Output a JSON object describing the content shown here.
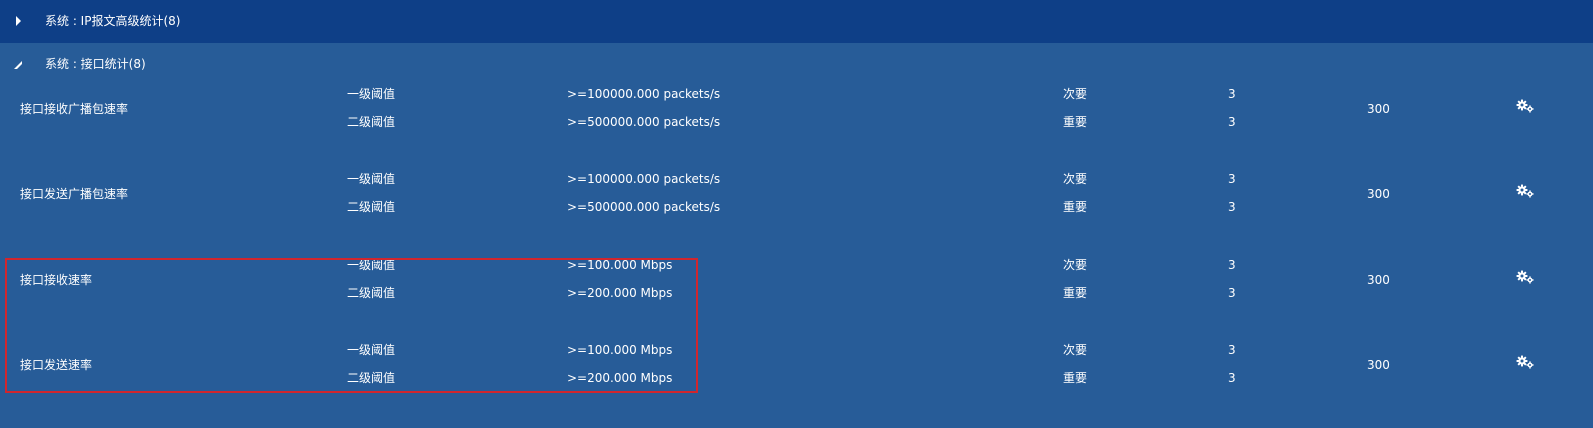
{
  "groups": {
    "collapsed": {
      "title": "系统 : IP报文高级统计(8)",
      "icon": "caret-right-icon"
    },
    "expanded": {
      "title": "系统 : 接口统计(8)",
      "icon": "caret-down-icon"
    }
  },
  "rows": [
    {
      "metric": "接口接收广播包速率",
      "levels": [
        {
          "level": "一级阈值",
          "condition": ">=100000.000 packets/s",
          "severity": "次要",
          "count": "3"
        },
        {
          "level": "二级阈值",
          "condition": ">=500000.000 packets/s",
          "severity": "重要",
          "count": "3"
        }
      ],
      "period": "300",
      "action_icon": "gears-icon"
    },
    {
      "metric": "接口发送广播包速率",
      "levels": [
        {
          "level": "一级阈值",
          "condition": ">=100000.000 packets/s",
          "severity": "次要",
          "count": "3"
        },
        {
          "level": "二级阈值",
          "condition": ">=500000.000 packets/s",
          "severity": "重要",
          "count": "3"
        }
      ],
      "period": "300",
      "action_icon": "gears-icon"
    },
    {
      "metric": "接口接收速率",
      "levels": [
        {
          "level": "一级阈值",
          "condition": ">=100.000 Mbps",
          "severity": "次要",
          "count": "3"
        },
        {
          "level": "二级阈值",
          "condition": ">=200.000 Mbps",
          "severity": "重要",
          "count": "3"
        }
      ],
      "period": "300",
      "action_icon": "gears-icon"
    },
    {
      "metric": "接口发送速率",
      "levels": [
        {
          "level": "一级阈值",
          "condition": ">=100.000 Mbps",
          "severity": "次要",
          "count": "3"
        },
        {
          "level": "二级阈值",
          "condition": ">=200.000 Mbps",
          "severity": "重要",
          "count": "3"
        }
      ],
      "period": "300",
      "action_icon": "gears-icon"
    }
  ],
  "colors": {
    "background": "#275C98",
    "collapsed_header": "#0E3F87",
    "highlight_border": "#D0262E",
    "text": "#FFFFFF"
  }
}
